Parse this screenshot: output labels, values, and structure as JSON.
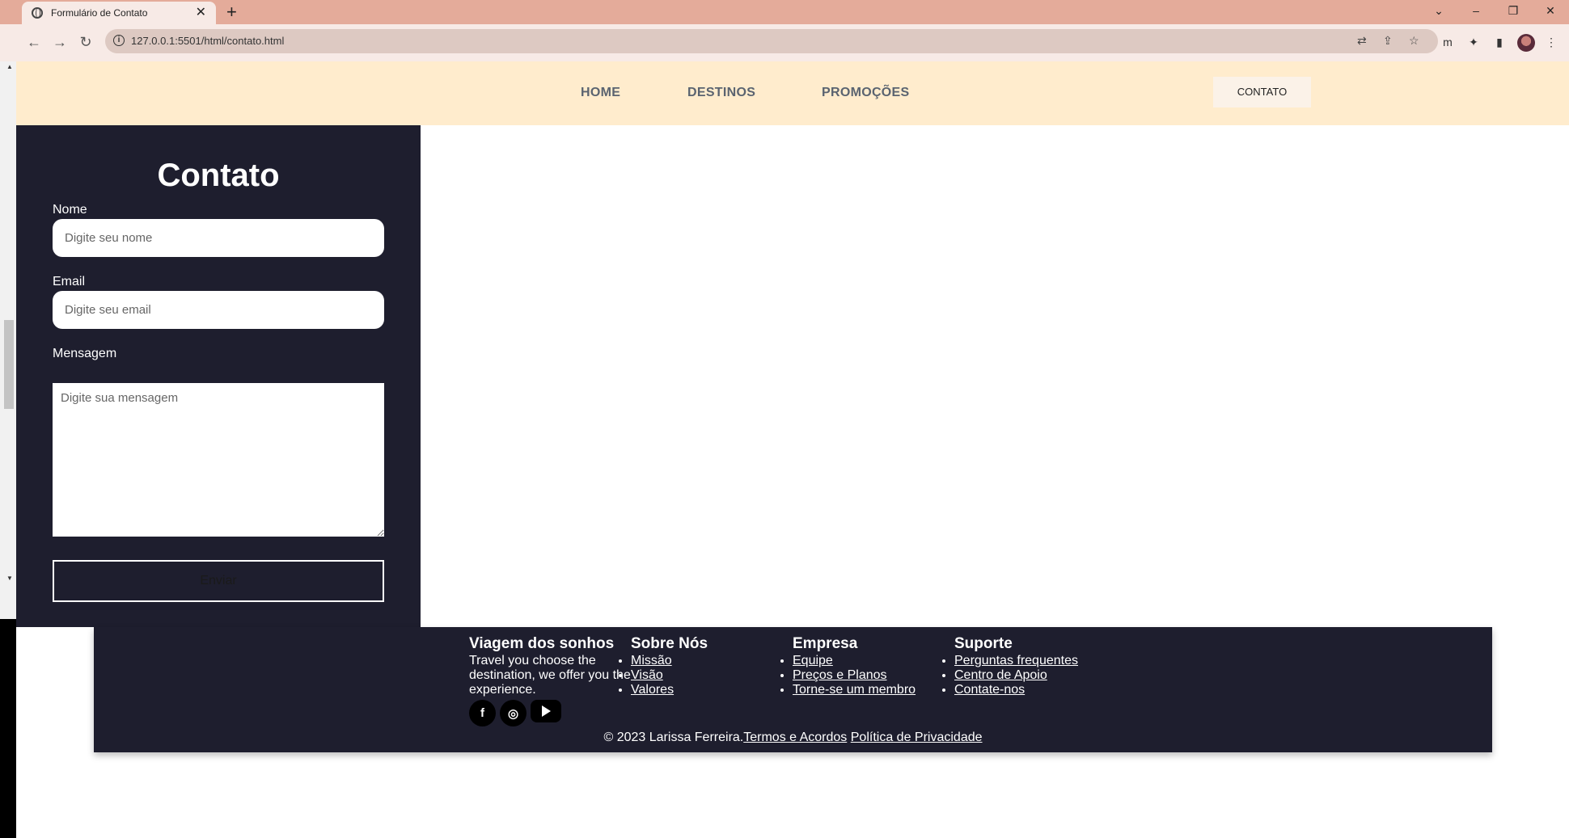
{
  "browser": {
    "tab_title": "Formulário de Contato",
    "url": "127.0.0.1:5501/html/contato.html",
    "new_tab": "+",
    "close_tab": "✕"
  },
  "nav": {
    "home": "HOME",
    "destinos": "DESTINOS",
    "promocoes": "PROMOÇÕES",
    "contato": "CONTATO"
  },
  "form": {
    "title": "Contato",
    "nome_label": "Nome",
    "nome_placeholder": "Digite seu nome",
    "email_label": "Email",
    "email_placeholder": "Digite seu email",
    "mensagem_label": "Mensagem",
    "mensagem_placeholder": "Digite sua mensagem",
    "submit_label": "Enviar"
  },
  "footer": {
    "brand_title": "Viagem dos sonhos",
    "brand_text": "Travel you choose the destination, we offer you the experience.",
    "sobre_title": "Sobre Nós",
    "sobre_items": [
      "Missão",
      "Visão",
      "Valores"
    ],
    "empresa_title": "Empresa",
    "empresa_items": [
      "Equipe",
      "Preços e Planos",
      "Torne-se um membro"
    ],
    "suporte_title": "Suporte",
    "suporte_items": [
      "Perguntas frequentes",
      "Centro de Apoio",
      "Contate-nos"
    ],
    "copyright": "© 2023 Larissa Ferreira.",
    "terms": "Termos e Acordos",
    "privacy": "Política de Privacidade",
    "social_icons": [
      "facebook-icon",
      "instagram-icon",
      "youtube-icon"
    ]
  },
  "colors": {
    "tabbar": "#e4ab9a",
    "header_bg": "#ffeccd",
    "panel_bg": "#1e1e2e",
    "nav_text": "#5a6370"
  }
}
